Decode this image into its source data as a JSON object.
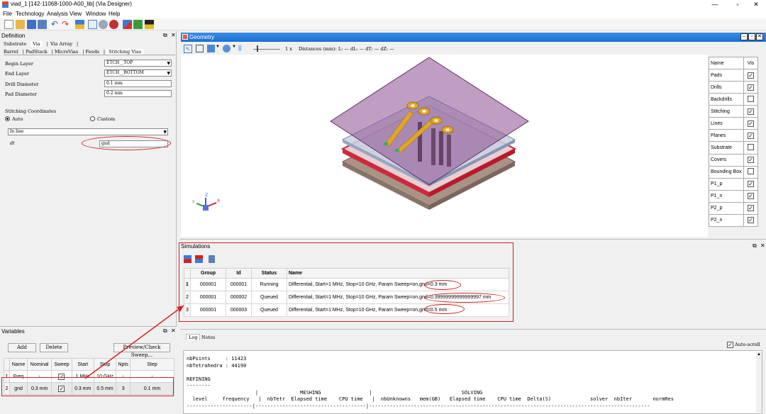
{
  "window": {
    "title": "viad_1 [142-11068-1000-A00_lib] (Via Designer)",
    "min": "—",
    "max": "▫",
    "close": "✕"
  },
  "menu": [
    "File",
    "Technology",
    "Analysis",
    "View",
    "Window",
    "Help"
  ],
  "definition": {
    "title": "Definition",
    "tabs_top": [
      "Substrate",
      "Via",
      "Via Array"
    ],
    "tabs_sub": [
      "Barrel",
      "PadStack",
      "MicroVias",
      "Feeds",
      "Stitching Vias"
    ],
    "begin_layer_label": "Begin Layer",
    "begin_layer": "ETCH__TOP",
    "end_layer_label": "End Layer",
    "end_layer": "ETCH__BOTTOM",
    "drill_label": "Drill Diameter",
    "drill": "0.1 mm",
    "pad_label": "Pad Diameter",
    "pad": "0.2 mm",
    "stitch_label": "Stitching Coordinates",
    "auto_label": "Auto",
    "custom_label": "Custom",
    "mode": "In line",
    "dt_label": "dt",
    "dt_value": "gnd"
  },
  "variables": {
    "title": "Variables",
    "add": "Add",
    "delete": "Delete",
    "preview": "Preview/Check Sweep...",
    "headers": [
      "",
      "Name",
      "Nominal",
      "Sweep",
      "Start",
      "Stop",
      "Npts",
      "Step"
    ],
    "rows": [
      {
        "n": "1",
        "name": "Freq",
        "nominal": "-",
        "start": "1 MHz",
        "stop": "10 GHz",
        "npts": "-",
        "step": "-"
      },
      {
        "n": "2",
        "name": "gnd",
        "nominal": "0.3 mm",
        "start": "0.3 mm",
        "stop": "0.5 mm",
        "npts": "3",
        "step": "0.1 mm"
      }
    ]
  },
  "geometry": {
    "title": "Geometry",
    "zoom": "1 x",
    "distances": "Distances (mm): L: — dL: — dT: — dZ: —",
    "vis_header": [
      "Name",
      "Vis"
    ],
    "vis_rows": [
      {
        "name": "Pads",
        "on": true
      },
      {
        "name": "Drills",
        "on": true
      },
      {
        "name": "Backdrills",
        "on": false
      },
      {
        "name": "Stitching",
        "on": true
      },
      {
        "name": "Lines",
        "on": true
      },
      {
        "name": "Planes",
        "on": true
      },
      {
        "name": "Substrate",
        "on": false
      },
      {
        "name": "Covers",
        "on": true
      },
      {
        "name": "Bounding Box",
        "on": false
      },
      {
        "name": "P1_p",
        "on": true
      },
      {
        "name": "P1_n",
        "on": true
      },
      {
        "name": "P2_p",
        "on": true
      },
      {
        "name": "P2_n",
        "on": true
      }
    ]
  },
  "simulations": {
    "title": "Simulations",
    "headers": [
      "",
      "Group",
      "Id",
      "Status",
      "Name"
    ],
    "rows": [
      {
        "n": "1",
        "group": "000001",
        "id": "000001",
        "status": "Running",
        "name": "Differential, Start=1 MHz, Stop=10 GHz, Param Sweep=on,",
        "param": "gnd=0.3 mm"
      },
      {
        "n": "2",
        "group": "000001",
        "id": "000002",
        "status": "Queued",
        "name": "Differential, Start=1 MHz, Stop=10 GHz, Param Sweep=on,",
        "param": "gnd=0.39999999999999997 mm"
      },
      {
        "n": "3",
        "group": "000001",
        "id": "000003",
        "status": "Queued",
        "name": "Differential, Start=1 MHz, Stop=10 GHz, Param Sweep=on,",
        "param": "gnd=0.5 mm"
      }
    ]
  },
  "log": {
    "tabs": [
      "Log",
      "Notes"
    ],
    "autoscroll": "Auto-scroll",
    "text": "nbPoints     : 11423\nnbTetrahedra : 44190\n\nREFINING\n--------\n                       |              MESHING                |                              SOLVING\n  level     frequency   |  nbTetr  Elapsed time    CPU time   |  nbUnknowns   mem(GB)   Elapsed time    CPU time  Delta(S)             solver  nbIter       normRes\n----------------------|-------------------------------------|----------------------------------------------------------------------------------------------"
  },
  "colors": {
    "accent": "#1c6fd0",
    "highlight": "#d62020",
    "cover": "#8a4f8e",
    "ground": "#a7928a"
  }
}
